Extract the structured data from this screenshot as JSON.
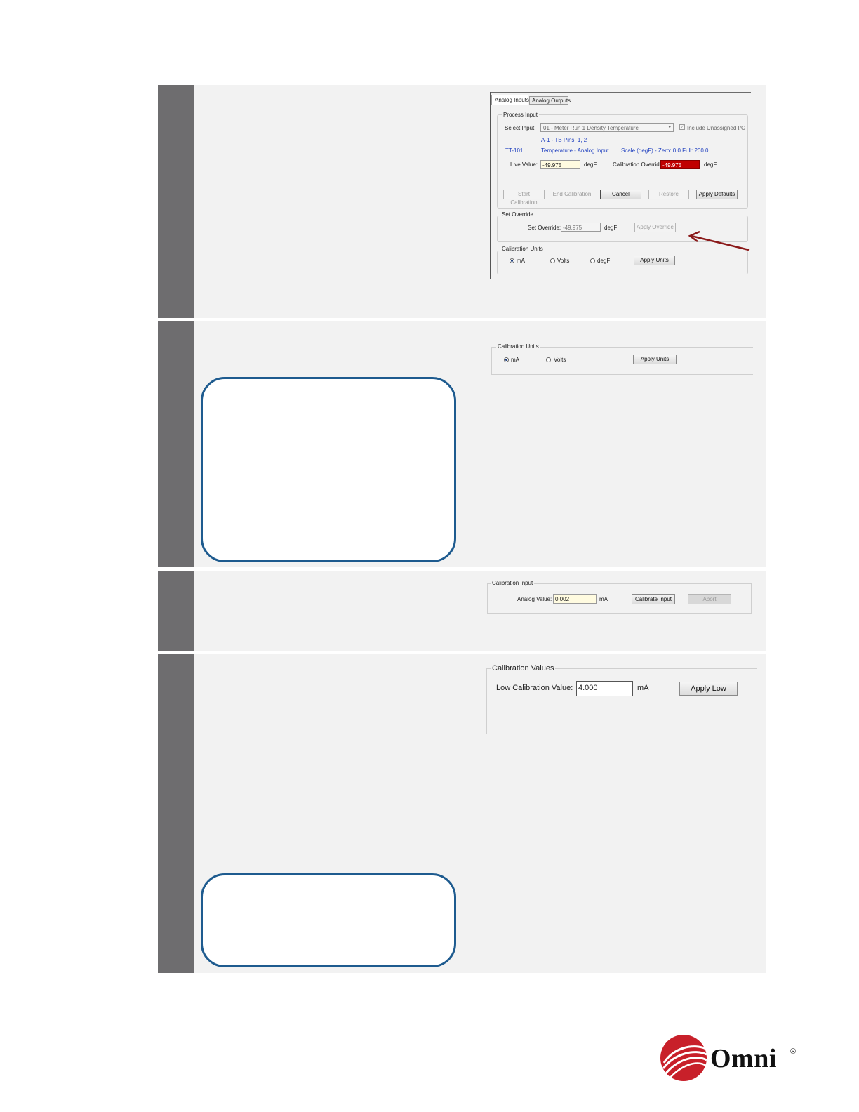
{
  "panel1": {
    "tabs": [
      "Analog Inputs",
      "Analog Outputs"
    ],
    "process_input": {
      "group_label": "Process Input",
      "select_input_label": "Select Input:",
      "select_input_value": "01 - Meter Run 1 Density Temperature",
      "include_unassigned_label": "Include Unassigned I/O",
      "include_unassigned_mark": "✓",
      "pins_text": "A-1 - TB Pins: 1, 2",
      "tag": "TT-101",
      "type_text": "Temperature - Analog Input",
      "scale_text": "Scale (degF) - Zero: 0.0  Full: 200.0",
      "live_value_label": "Live Value:",
      "live_value": "-49.975",
      "live_unit": "degF",
      "cal_override_label": "Calibration Override:",
      "cal_override_value": "-49.975",
      "cal_override_unit": "degF"
    },
    "buttons": {
      "start_calibration": "Start Calibration",
      "end_calibration": "End Calibration",
      "cancel": "Cancel",
      "restore": "Restore",
      "apply_defaults": "Apply Defaults"
    },
    "set_override": {
      "group_label": "Set Override",
      "field_label": "Set Override:",
      "value": "-49.975",
      "unit": "degF",
      "apply_label": "Apply Override"
    },
    "calibration_units": {
      "group_label": "Calibration Units",
      "options": [
        "mA",
        "Volts",
        "degF"
      ],
      "selected": "mA",
      "apply_label": "Apply Units"
    },
    "arrow_color": "#8b1a1a"
  },
  "panel2": {
    "calibration_units": {
      "group_label": "Calibration Units",
      "options": [
        "mA",
        "Volts"
      ],
      "selected": "mA",
      "apply_label": "Apply Units"
    }
  },
  "panel3": {
    "calibration_input": {
      "group_label": "Calibration  Input",
      "analog_value_label": "Analog Value:",
      "analog_value": "0.002",
      "unit": "mA",
      "calibrate_label": "Calibrate Input",
      "abort_label": "Abort"
    }
  },
  "panel4": {
    "calibration_values": {
      "group_label": "Calibration Values",
      "low_label": "Low Calibration Value:",
      "low_value": "4.000",
      "unit": "mA",
      "apply_low_label": "Apply Low"
    }
  },
  "brand": {
    "name": "Omni",
    "registered": "®",
    "color": "#c8202a"
  }
}
